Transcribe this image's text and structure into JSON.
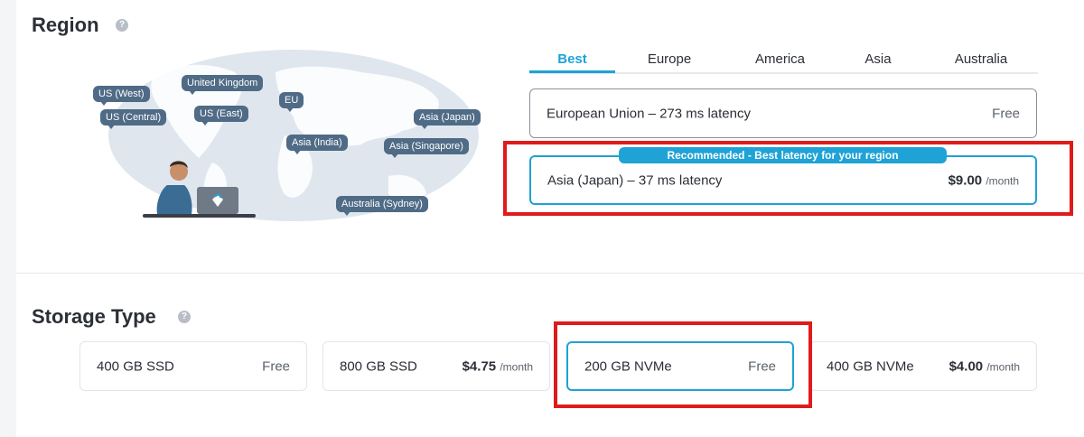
{
  "region": {
    "title": "Region",
    "help": "?",
    "map_pins": [
      "US (West)",
      "United Kingdom",
      "US (Central)",
      "US (East)",
      "EU",
      "Asia (Japan)",
      "Asia (India)",
      "Asia (Singapore)",
      "Australia (Sydney)"
    ],
    "tabs": [
      "Best",
      "Europe",
      "America",
      "Asia",
      "Australia"
    ],
    "active_tab": "Best",
    "options": [
      {
        "label": "European Union – 273 ms latency",
        "price": "Free"
      },
      {
        "label": "Asia (Japan) – 37 ms latency",
        "price": "$9.00",
        "per": "/month",
        "badge": "Recommended - Best latency for your region"
      }
    ]
  },
  "storage": {
    "title": "Storage Type",
    "help": "?",
    "options": [
      {
        "label": "400 GB SSD",
        "price": "Free"
      },
      {
        "label": "800 GB SSD",
        "price": "$4.75",
        "per": "/month"
      },
      {
        "label": "200 GB NVMe",
        "price": "Free"
      },
      {
        "label": "400 GB NVMe",
        "price": "$4.00",
        "per": "/month"
      }
    ]
  },
  "colors": {
    "accent": "#1fa2d6",
    "highlight": "#e01b1b",
    "pin": "#4f6b86"
  }
}
